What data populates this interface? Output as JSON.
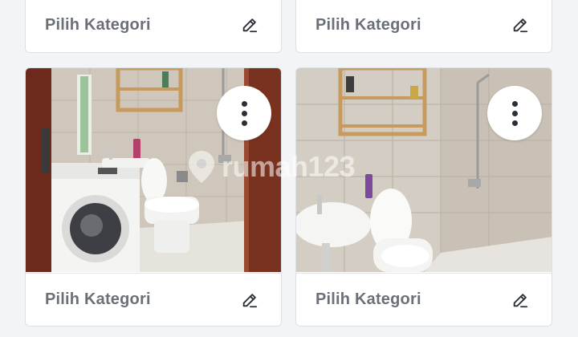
{
  "cards": [
    {
      "label": "Pilih Kategori",
      "edit_icon": "pencil-icon"
    },
    {
      "label": "Pilih Kategori",
      "edit_icon": "pencil-icon"
    },
    {
      "label": "Pilih Kategori",
      "edit_icon": "pencil-icon",
      "menu_icon": "more-vertical-icon"
    },
    {
      "label": "Pilih Kategori",
      "edit_icon": "pencil-icon",
      "menu_icon": "more-vertical-icon"
    }
  ],
  "watermark": {
    "text": "rumah123"
  },
  "colors": {
    "background": "#f3f4f6",
    "card": "#ffffff",
    "label": "#6b7078",
    "icon": "#2b2f36"
  }
}
